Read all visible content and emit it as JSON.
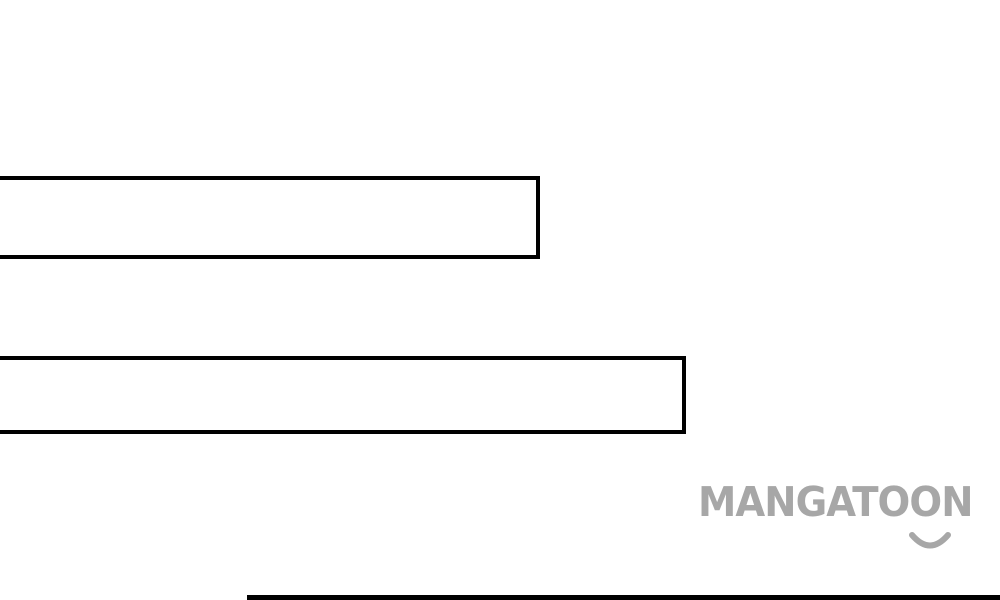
{
  "page": {
    "background": "#ffffff",
    "border_color": "#000000"
  },
  "boxes": [
    {
      "name": "top-empty-box",
      "text": ""
    },
    {
      "name": "bottom-empty-box",
      "text": ""
    }
  ],
  "watermark": {
    "text": "MANGATOON",
    "color": "#a7a7a7",
    "icon": "smile-icon"
  }
}
